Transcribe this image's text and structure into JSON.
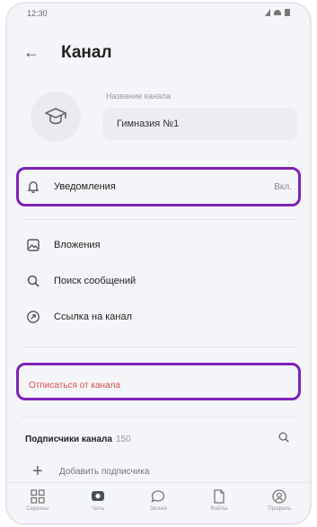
{
  "status_bar": {
    "time": "12:30"
  },
  "header": {
    "title": "Канал"
  },
  "channel": {
    "name_caption": "Название канала",
    "name_value": "Гимназия №1"
  },
  "notifications": {
    "label": "Уведомления",
    "value": "Вкл."
  },
  "menu": {
    "attachments": "Вложения",
    "search_messages": "Поиск сообщений",
    "channel_link": "Ссылка на канал"
  },
  "unsubscribe_label": "Отписаться от канала",
  "subscribers": {
    "title": "Подписчики канала",
    "count": "150",
    "add_label": "Добавить подписчика"
  },
  "tabbar": {
    "tabs": [
      {
        "label": "Сервисы",
        "icon": "grid-icon"
      },
      {
        "label": "Чаты",
        "icon": "chat-active-icon"
      },
      {
        "label": "Звонки",
        "icon": "bubble-icon"
      },
      {
        "label": "Файлы",
        "icon": "file-icon"
      },
      {
        "label": "Профиль",
        "icon": "profile-icon"
      }
    ]
  },
  "colors": {
    "highlight": "#7f22b8",
    "danger": "#d85050",
    "background": "#f4f5f8"
  }
}
